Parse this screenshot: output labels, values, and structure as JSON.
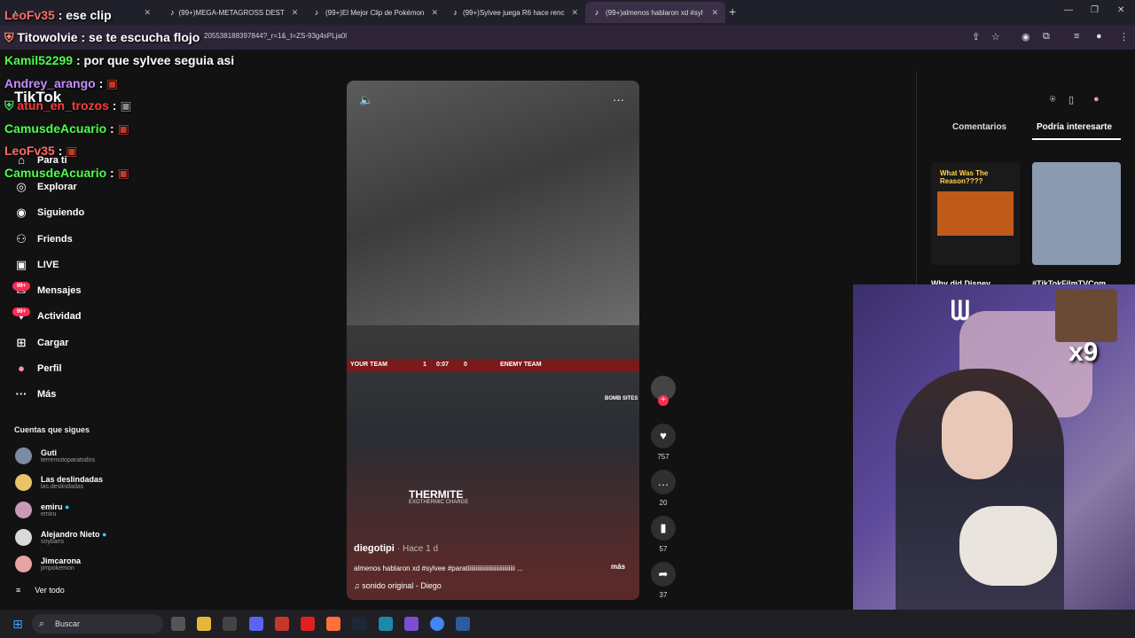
{
  "browser": {
    "tabs": [
      {
        "label": ""
      },
      {
        "label": "(99+)MEGA-METAGROSS DEST"
      },
      {
        "label": "(99+)El Mejor Clip de Pokémon"
      },
      {
        "label": "(99+)Sylvee juega R6 hace renc"
      },
      {
        "label": "(99+)almenos hablaron xd #syl"
      }
    ],
    "url": "205538188397844?_r=1&_t=ZS-93g4sPLja0l"
  },
  "chat": [
    {
      "user": "LeoFv35",
      "msg": "ese clip",
      "color": "#ff6b6b"
    },
    {
      "user": "Titowolvie",
      "msg": "se te escucha flojo",
      "color": "#ffffff"
    },
    {
      "user": "Kamil52299",
      "msg": "por que sylvee seguia asi",
      "color": "#4cff4c"
    },
    {
      "user": "Andrey_arango",
      "msg": "",
      "color": "#c58cff"
    },
    {
      "user": "atun_en_trozos",
      "msg": "",
      "color": "#ff3b3b"
    },
    {
      "user": "CamusdeAcuario",
      "msg": "",
      "color": "#4cff4c"
    },
    {
      "user": "LeoFv35",
      "msg": "",
      "color": "#ff6b6b"
    },
    {
      "user": "CamusdeAcuario",
      "msg": "",
      "color": "#4cff4c"
    }
  ],
  "tiktok": {
    "logo": "TikTok",
    "nav": [
      {
        "label": "Para ti",
        "icon": "home-icon"
      },
      {
        "label": "Explorar",
        "icon": "compass-icon"
      },
      {
        "label": "Siguiendo",
        "icon": "following-icon"
      },
      {
        "label": "Friends",
        "icon": "friends-icon"
      },
      {
        "label": "LIVE",
        "icon": "live-icon"
      },
      {
        "label": "Mensajes",
        "icon": "messages-icon",
        "badge": "99+"
      },
      {
        "label": "Actividad",
        "icon": "activity-icon",
        "badge": "99+"
      },
      {
        "label": "Cargar",
        "icon": "upload-icon"
      },
      {
        "label": "Perfil",
        "icon": "profile-icon"
      },
      {
        "label": "Más",
        "icon": "more-icon"
      }
    ],
    "following_title": "Cuentas que sigues",
    "following": [
      {
        "name": "Guti",
        "handle": "terremotoparatodos",
        "color": "#7b8ca3"
      },
      {
        "name": "Las deslindadas",
        "handle": "las.deslindadas",
        "color": "#e8c46a"
      },
      {
        "name": "emiru",
        "handle": "emiru",
        "verified": true,
        "color": "#c99ab8"
      },
      {
        "name": "Alejandro Nieto",
        "handle": "soybans",
        "verified": true,
        "color": "#d9d9d9"
      },
      {
        "name": "Jimcarona",
        "handle": "jimpokemon",
        "color": "#e8a4a4"
      }
    ],
    "see_all": "Ver todo",
    "video": {
      "author": "diegotipi",
      "ago": "· Hace 1 d",
      "caption": "almenos hablaron xd #sylvee #paratiiiiiiiiiiiiiiiiiiiiiiiiiiiiii ...",
      "more": "más",
      "music": "sonido original - Diego",
      "game": {
        "your_team": "YOUR TEAM",
        "score_left": "1",
        "timer": "0:07",
        "score_right": "0",
        "enemy_team": "ENEMY TEAM",
        "operator": "THERMITE",
        "gadget": "EXOTHERMIC CHARGE",
        "bomb": "BOMB SITES"
      },
      "likes": "757",
      "comments": "20",
      "saves": "57",
      "shares": "37"
    },
    "right_tabs": [
      "Comentarios",
      "Podría interesarte"
    ],
    "thumb1_text": "What Was The Reason????",
    "thumb_titles": [
      "Why did Disney",
      "#TikTokFilmTVCom"
    ]
  },
  "webcam": {
    "overlay_text": "x9"
  },
  "taskbar": {
    "search": "Buscar"
  }
}
